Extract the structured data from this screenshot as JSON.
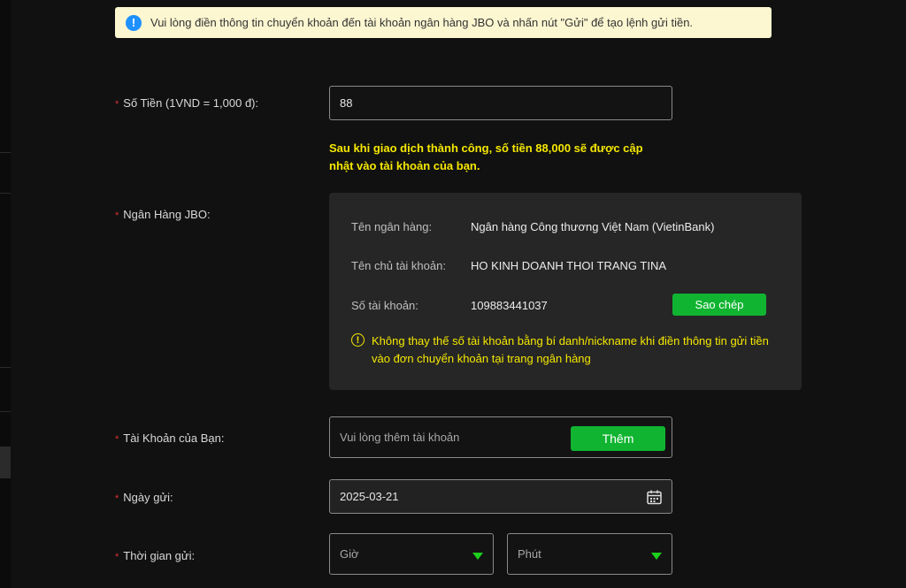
{
  "notice": {
    "icon": "info-icon",
    "text": "Vui lòng điền thông tin chuyển khoản đến tài khoản ngân hàng JBO và nhấn nút \"Gửi\" để tạo lệnh gửi tiền."
  },
  "required_mark": "*",
  "amount": {
    "label": "Số Tiền (1VND = 1,000 đ):",
    "value": "88",
    "note": "Sau khi giao dịch thành công, số tiền 88,000 sẽ được cập nhật vào tài khoản của bạn."
  },
  "bank": {
    "label": "Ngân Hàng JBO:",
    "bank_name_label": "Tên ngân hàng:",
    "bank_name": "Ngân hàng Công thương Việt Nam (VietinBank)",
    "holder_label": "Tên chủ tài khoản:",
    "holder": "HO KINH DOANH THOI TRANG TINA",
    "account_label": "Số tài khoản:",
    "account": "109883441037",
    "copy_button": "Sao chép",
    "warning": "Không thay thế số tài khoản bằng bí danh/nickname khi điền thông tin gửi tiền vào đơn chuyển khoản tại trang ngân hàng"
  },
  "your_account": {
    "label": "Tài Khoản của Bạn:",
    "placeholder": "Vui lòng thêm tài khoản",
    "add_button": "Thêm"
  },
  "date": {
    "label": "Ngày gửi:",
    "value": "2025-03-21",
    "icon": "calendar-icon"
  },
  "time": {
    "label": "Thời gian gửi:",
    "hour_placeholder": "Giờ",
    "minute_placeholder": "Phút"
  },
  "colors": {
    "accent_green": "#10b431",
    "warning_yellow": "#f5e800",
    "notice_bg": "#fdf7d1",
    "info_blue": "#1e90ff",
    "required_red": "#e03030"
  }
}
